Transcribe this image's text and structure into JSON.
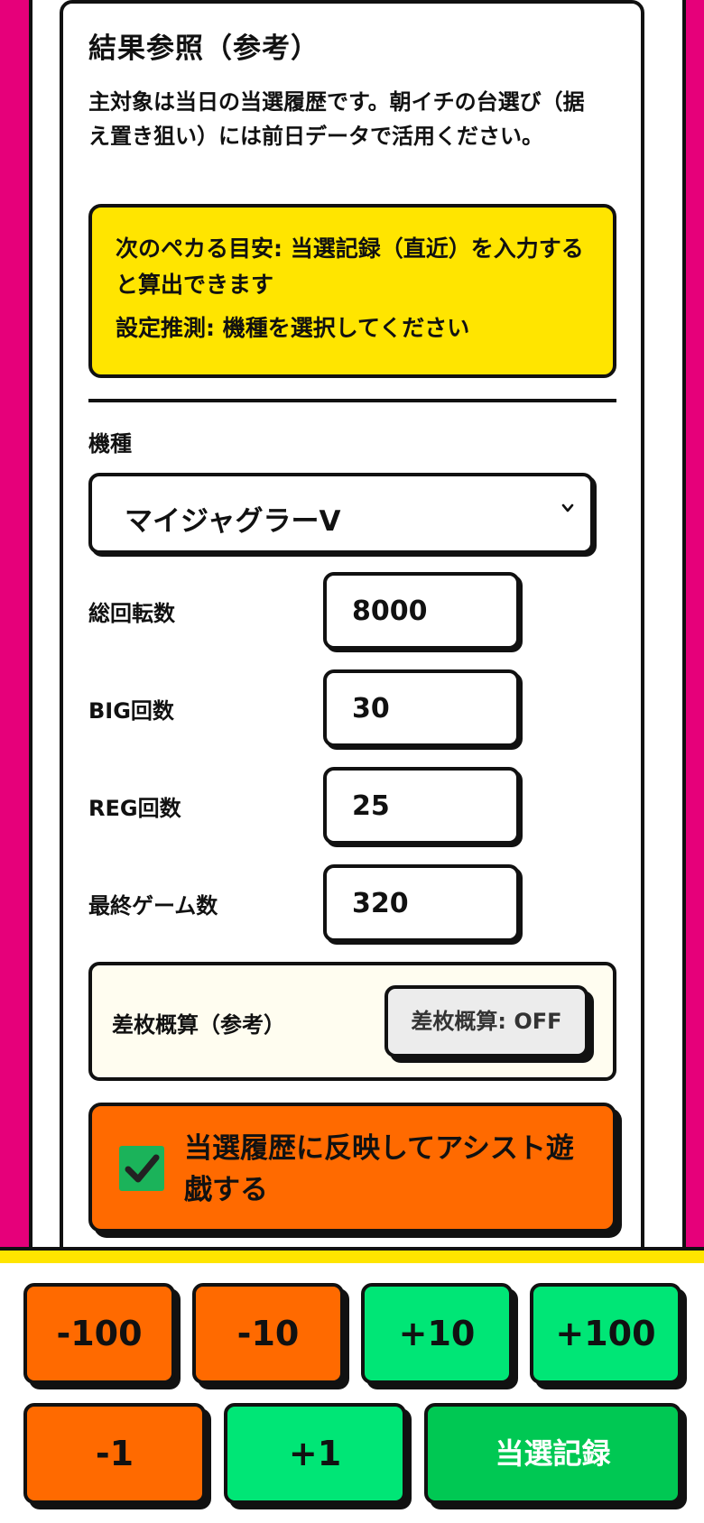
{
  "card": {
    "title": "結果参照（参考）",
    "description": "主対象は当日の当選履歴です。朝イチの台選び（据え置き狙い）には前日データで活用ください。",
    "notice": {
      "line1": "次のペカる目安: 当選記録（直近）を入力すると算出できます",
      "line2": "設定推測: 機種を選択してください"
    }
  },
  "machine": {
    "label": "機種",
    "selected": "マイジャグラーV"
  },
  "fields": {
    "total_spins": {
      "label": "総回転数",
      "value": "8000"
    },
    "big_count": {
      "label": "BIG回数",
      "value": "30"
    },
    "reg_count": {
      "label": "REG回数",
      "value": "25"
    },
    "last_games": {
      "label": "最終ゲーム数",
      "value": "320"
    }
  },
  "diff": {
    "label": "差枚概算（参考）",
    "button": "差枚概算: OFF"
  },
  "assist": {
    "checked": true,
    "label": "当選履歴に反映してアシスト遊戯する"
  },
  "keypad": {
    "minus100": "-100",
    "minus10": "-10",
    "plus10": "+10",
    "plus100": "+100",
    "minus1": "-1",
    "plus1": "+1",
    "record": "当選記録"
  },
  "colors": {
    "page_bg": "#e6007a",
    "notice_bg": "#ffe500",
    "orange": "#ff6a00",
    "green": "#00e676",
    "dark_green": "#00c853"
  },
  "icons": {
    "select": "chevron-down-icon",
    "checkbox": "checkmark-icon"
  }
}
